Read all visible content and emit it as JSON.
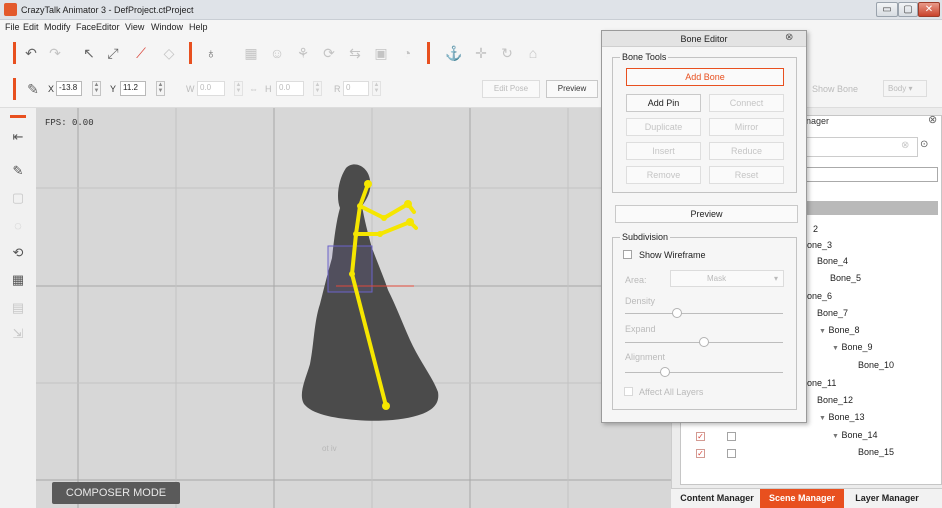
{
  "window": {
    "title": "CrazyTalk Animator 3  - DefProject.ctProject",
    "controls": {
      "minimize": "▭",
      "restore": "▢",
      "close": "✕"
    }
  },
  "menu": [
    "File",
    "Edit",
    "Modify",
    "FaceEditor",
    "View",
    "Window",
    "Help"
  ],
  "transform": {
    "x_label": "X",
    "x_value": "-13.8",
    "y_label": "Y",
    "y_value": "11.2",
    "w_label": "W",
    "w_value": "0.0",
    "h_label": "H",
    "h_value": "0.0",
    "r_label": "R",
    "r_value": "0",
    "edit_pose": "Edit Pose",
    "preview": "Preview",
    "show_bone": "Show Bone",
    "body": "Body"
  },
  "viewport": {
    "fps": "FPS: 0.00",
    "composer_mode": "COMPOSER MODE",
    "ruler_text": "ot iv"
  },
  "bone_editor": {
    "title": "Bone Editor",
    "bone_tools_label": "Bone Tools",
    "add_bone": "Add Bone",
    "add_pin": "Add Pin",
    "connect": "Connect",
    "duplicate": "Duplicate",
    "mirror": "Mirror",
    "insert": "Insert",
    "reduce": "Reduce",
    "remove": "Remove",
    "reset": "Reset",
    "preview": "Preview",
    "subdivision_label": "Subdivision",
    "show_wireframe": "Show Wireframe",
    "area_label": "Area:",
    "area_value": "Mask",
    "density_label": "Density",
    "density_level": 0.33,
    "expand_label": "Expand",
    "expand_level": 0.5,
    "alignment_label": "Alignment",
    "alignment_level": 0.25,
    "affect_all_layers": "Affect All Layers"
  },
  "scene_manager": {
    "title_partial": "nager",
    "tree": [
      {
        "label": "2"
      },
      {
        "label": "one_3"
      },
      {
        "label": "Bone_4"
      },
      {
        "label": "Bone_5"
      },
      {
        "label": "one_6"
      },
      {
        "label": "Bone_7"
      },
      {
        "label": "Bone_8",
        "arrow": "▼"
      },
      {
        "label": "Bone_9",
        "arrow": "▼"
      },
      {
        "label": "Bone_10"
      },
      {
        "label": "one_11"
      },
      {
        "label": "Bone_12"
      },
      {
        "label": "Bone_13",
        "arrow": "▼"
      },
      {
        "label": "Bone_14",
        "arrow": "▼"
      },
      {
        "label": "Bone_15"
      }
    ],
    "tabs": [
      "Content Manager",
      "Scene Manager",
      "Layer Manager"
    ]
  },
  "colors": {
    "accent": "#e8501f",
    "bone": "#f5e600",
    "viewport": "#d7d7d7"
  },
  "icons": {
    "toolbar": [
      "undo-icon",
      "redo-icon",
      "select-icon",
      "transform-icon",
      "bone-tool-icon",
      "deform-icon",
      "sprite-icon",
      "puppet-icon",
      "expression-icon",
      "motion-icon",
      "pin-icon",
      "move-icon",
      "rotate-icon",
      "home-icon"
    ],
    "sidebar": [
      "collapse-icon",
      "pen-icon",
      "layer-icon",
      "morph-icon",
      "replace-icon",
      "grid-icon",
      "sprite-list-icon",
      "export-icon"
    ]
  }
}
